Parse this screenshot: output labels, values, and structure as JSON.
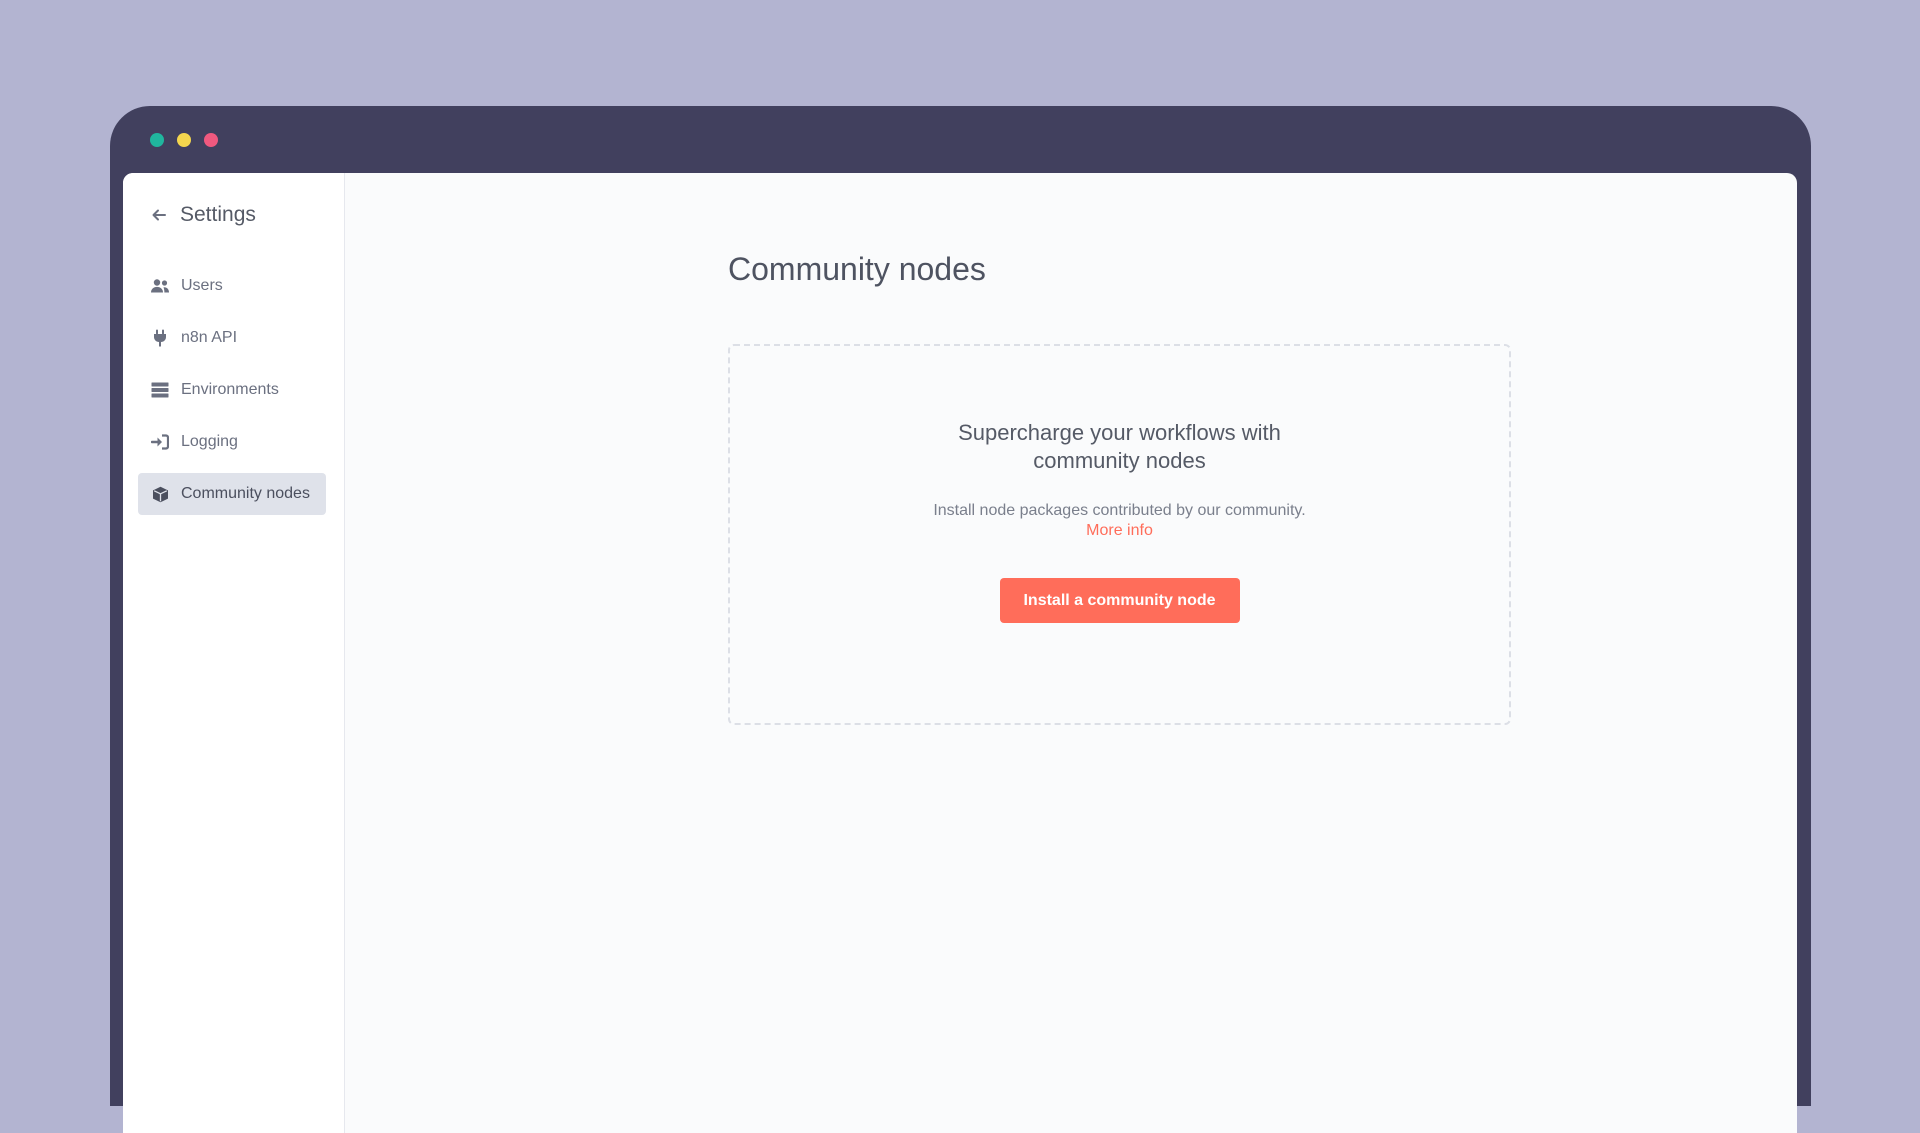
{
  "window": {
    "traffic_lights": [
      "green",
      "yellow",
      "red"
    ],
    "colors": {
      "background": "#b3b4d1",
      "frame": "#41405e",
      "accent": "#ff6d5a"
    }
  },
  "sidebar": {
    "back_icon": "arrow-left-icon",
    "title": "Settings",
    "items": [
      {
        "label": "Users",
        "icon": "users-icon",
        "active": false
      },
      {
        "label": "n8n API",
        "icon": "plug-icon",
        "active": false
      },
      {
        "label": "Environments",
        "icon": "server-icon",
        "active": false
      },
      {
        "label": "Logging",
        "icon": "sign-in-icon",
        "active": false
      },
      {
        "label": "Community nodes",
        "icon": "cube-icon",
        "active": true
      }
    ]
  },
  "main": {
    "title": "Community nodes",
    "empty_state": {
      "heading": "Supercharge your workflows with community nodes",
      "description": "Install node packages contributed by our community.",
      "link_label": "More info",
      "button_label": "Install a community node"
    }
  }
}
